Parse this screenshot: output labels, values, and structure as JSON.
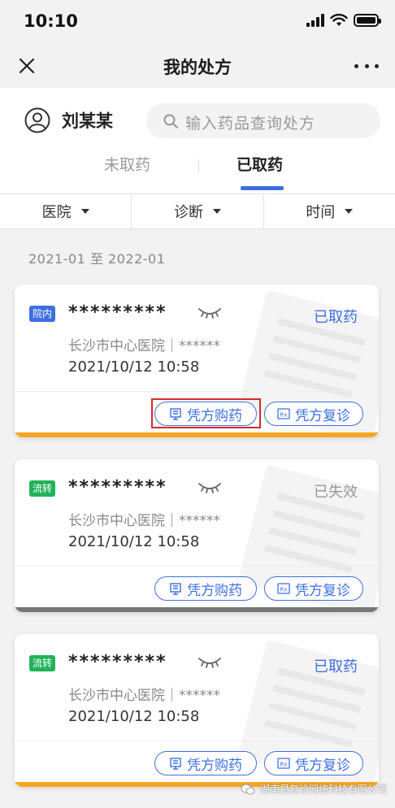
{
  "status_bar": {
    "time": "10:10"
  },
  "nav": {
    "title": "我的处方"
  },
  "user": {
    "name": "刘某某"
  },
  "search": {
    "placeholder": "输入药品查询处方"
  },
  "tabs": [
    {
      "label": "未取药",
      "active": false
    },
    {
      "label": "已取药",
      "active": true
    }
  ],
  "filters": [
    {
      "label": "医院"
    },
    {
      "label": "诊断"
    },
    {
      "label": "时间"
    }
  ],
  "date_range": "2021-01 至 2022-01",
  "colors": {
    "accent": "#3d6fe0",
    "tag_in_hospital": "#3d6fe0",
    "tag_transfer": "#21b25a",
    "status_picked": "#3d6fe0",
    "status_expired": "#999999",
    "stripe_orange": "#f5a623",
    "stripe_gray": "#777777"
  },
  "cards": [
    {
      "tag": "院内",
      "name": "*********",
      "status": "已取药",
      "hospital": "长沙市中心医院｜******",
      "datetime": "2021/10/12 10:58",
      "btn_buy": "凭方购药",
      "btn_revisit": "凭方复诊"
    },
    {
      "tag": "流转",
      "name": "*********",
      "status": "已失效",
      "hospital": "长沙市中心医院｜******",
      "datetime": "2021/10/12 10:58",
      "btn_buy": "凭方购药",
      "btn_revisit": "凭方复诊"
    },
    {
      "tag": "流转",
      "name": "*********",
      "status": "已取药",
      "hospital": "长沙市中心医院｜******",
      "datetime": "2021/10/12 10:58",
      "btn_buy": "凭方购药",
      "btn_revisit": "凭方复诊"
    }
  ],
  "footer_watermark": "湖南易复诊网络科技有限公司"
}
